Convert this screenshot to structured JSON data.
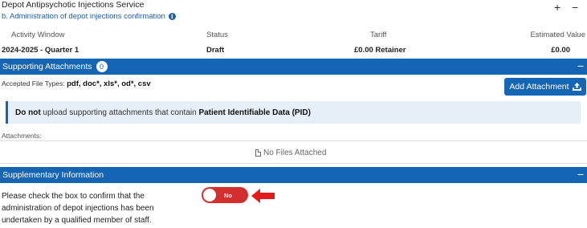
{
  "service": {
    "title": "Depot Antipsychotic Injections Service",
    "subtitle": "b. Administration of depot injections confirmation",
    "info_icon": "info-icon",
    "expand_symbol": "+",
    "collapse_symbol": "−"
  },
  "summary_table": {
    "headers": [
      "Activity Window",
      "Status",
      "Tariff",
      "Estimated Value"
    ],
    "values": [
      "2024-2025 - Quarter 1",
      "Draft",
      "£0.00 Retainer",
      "£0.00"
    ]
  },
  "attachments": {
    "section_title": "Supporting Attachments",
    "count": "0",
    "collapse_symbol": "−",
    "accepted_label": "Accepted File Types:",
    "accepted_types": "pdf, doc*, xls*, od*, csv",
    "add_button_label": "Add Attachment",
    "add_button_icon": "upload-icon",
    "alert": {
      "strong_prefix": "Do not",
      "text": " upload supporting attachments that contain ",
      "strong_suffix": "Patient Identifiable Data (PID)"
    },
    "list_label": "Attachments:",
    "empty_text": "No Files Attached",
    "empty_icon": "file-icon"
  },
  "supplementary": {
    "section_title": "Supplementary Information",
    "collapse_symbol": "−",
    "confirm_text": "Please check the box to confirm that the administration of depot injections has been undertaken by a qualified member of staff.",
    "toggle_label": "No",
    "toggle_color": "#d32f2f",
    "annotation": "red-arrow-pointing-left"
  },
  "colors": {
    "primary": "#1565b5",
    "alert_bg": "#e6eef6",
    "danger": "#d32f2f"
  }
}
